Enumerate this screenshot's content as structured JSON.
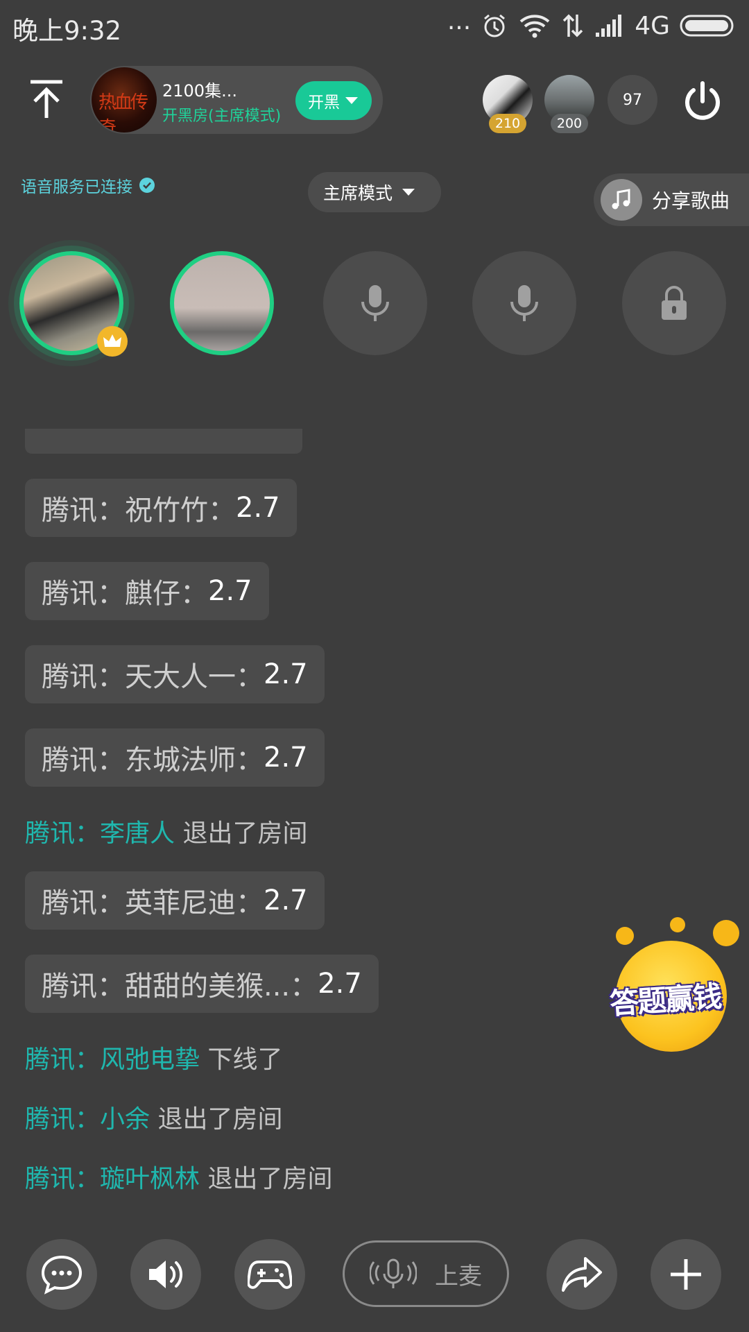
{
  "status_bar": {
    "time": "晚上9:32",
    "dots": "...",
    "network": "4G"
  },
  "header": {
    "room_name": "2100集...",
    "room_mode": "开黑房(主席模式)",
    "kaihei_label": "开黑",
    "logo_text": "热血传奇",
    "top_users": [
      {
        "score": "210"
      },
      {
        "score": "200"
      }
    ],
    "online_count": "97"
  },
  "subheader": {
    "voice_status": "语音服务已连接",
    "mode_label": "主席模式",
    "share_song_label": "分享歌曲"
  },
  "seats": [
    {
      "state": "occupied",
      "host": true
    },
    {
      "state": "occupied",
      "host": false
    },
    {
      "state": "empty",
      "icon": "mic-icon"
    },
    {
      "state": "empty",
      "icon": "mic-icon"
    },
    {
      "state": "locked",
      "icon": "lock-icon"
    }
  ],
  "chat": {
    "bubbles": [
      {
        "name": "腾讯：祝竹竹：",
        "value": "2.7"
      },
      {
        "name": "腾讯：麒仔：",
        "value": "2.7"
      },
      {
        "name": "腾讯：天大人一：",
        "value": "2.7"
      },
      {
        "name": "腾讯：东城法师：",
        "value": "2.7"
      },
      {
        "name": "腾讯：英菲尼迪：",
        "value": "2.7"
      },
      {
        "name": "腾讯：甜甜的美猴...：",
        "value": "2.7"
      }
    ],
    "system_lines": [
      {
        "prefix": "腾讯：",
        "who": "李唐人",
        "action": " 退出了房间"
      },
      {
        "prefix": "腾讯：",
        "who": "风弛电挚",
        "action": " 下线了"
      },
      {
        "prefix": "腾讯：",
        "who": "小余",
        "action": " 退出了房间"
      },
      {
        "prefix": "腾讯：",
        "who": "璇叶枫林",
        "action": " 退出了房间"
      }
    ]
  },
  "floating": {
    "quiz_label": "答题赢钱"
  },
  "toolbar": {
    "mic_up_label": "上麦"
  },
  "colors": {
    "background": "#3d3d3d",
    "accent_green": "#19c997",
    "teal_name": "#1fb7ae",
    "status_blue": "#5cd3dd",
    "gold": "#d5a431"
  }
}
